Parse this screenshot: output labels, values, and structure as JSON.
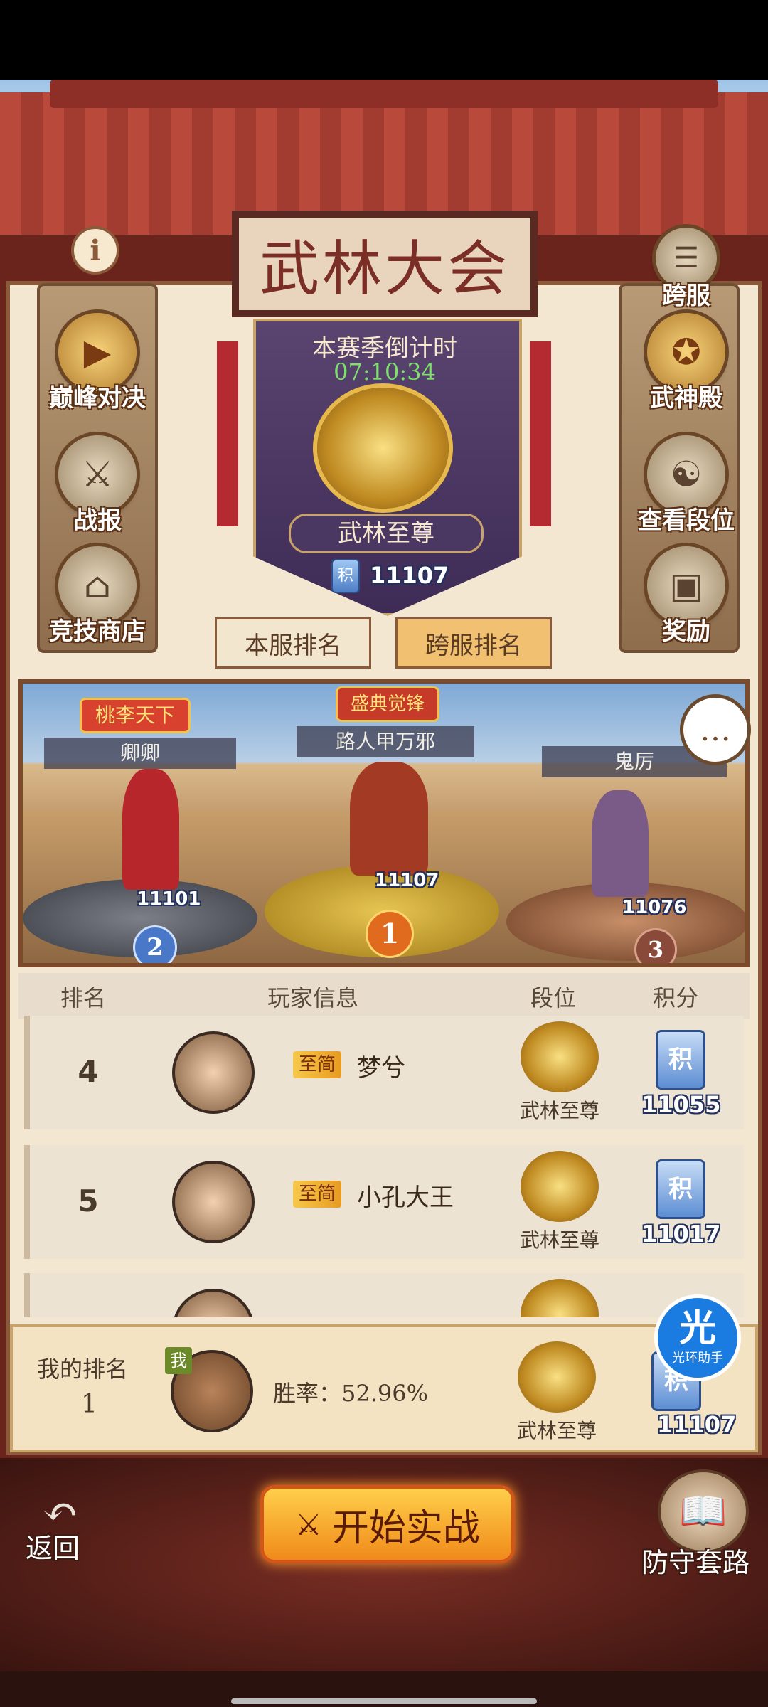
{
  "title": "武林大会",
  "left_menu": [
    {
      "label": "巅峰对决",
      "icon": "play-icon"
    },
    {
      "label": "战报",
      "icon": "scroll-icon"
    },
    {
      "label": "竞技商店",
      "icon": "shop-icon"
    }
  ],
  "right_menu": [
    {
      "label": "跨服",
      "icon": "list-icon"
    },
    {
      "label": "武神殿",
      "icon": "shrine-icon"
    },
    {
      "label": "查看段位",
      "icon": "dragon-icon"
    },
    {
      "label": "奖励",
      "icon": "chest-icon"
    }
  ],
  "season": {
    "countdown_label": "本赛季倒计时",
    "countdown": "07:10:34",
    "rank_title": "武林至尊",
    "score_icon": "积",
    "score": "11107"
  },
  "tabs": [
    "本服排名",
    "跨服排名"
  ],
  "podium": {
    "event_badge_left": "桃李天下",
    "event_badge_center": "盛典觉锋",
    "first": {
      "name": "路人甲万邪",
      "score": "11107",
      "place": "1"
    },
    "second": {
      "name": "卿卿",
      "score": "11101",
      "place": "2"
    },
    "third": {
      "name": "鬼厉",
      "score": "11076",
      "place": "3"
    }
  },
  "table": {
    "headers": [
      "排名",
      "玩家信息",
      "段位",
      "积分"
    ],
    "rows": [
      {
        "rank": "4",
        "vip": "至简",
        "name": "梦兮",
        "tier": "武林至尊",
        "score": "11055"
      },
      {
        "rank": "5",
        "vip": "至简",
        "name": "小孔大王",
        "tier": "武林至尊",
        "score": "11017"
      }
    ]
  },
  "me": {
    "label": "我的排名",
    "rank": "1",
    "badge": "我",
    "winrate": "胜率：52.96%",
    "tier": "武林至尊",
    "score": "11107"
  },
  "helper": {
    "glyph": "光",
    "label": "光环助手"
  },
  "bottom": {
    "back": "返回",
    "start": "开始实战",
    "defense": "防守套路"
  },
  "icons": {
    "info": "i",
    "chat": "…",
    "ji": "积"
  }
}
